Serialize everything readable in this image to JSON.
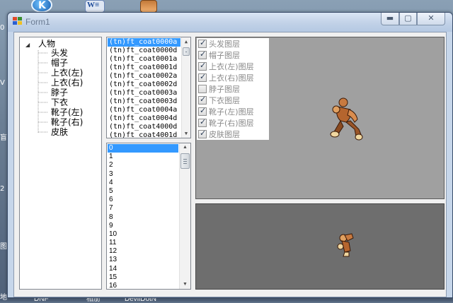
{
  "window": {
    "title": "Form1",
    "buttons": {
      "minimize": "▬",
      "maximize": "▢",
      "close": "✕"
    }
  },
  "desktop": {
    "icon_k_letter": "K",
    "icon_w_letter": "W≡",
    "left_chars": [
      "0",
      "Ⅴ",
      "盲",
      "2",
      "图",
      "地"
    ],
    "taskbar_labels": [
      "DNF",
      "相册",
      "DevilDotN"
    ]
  },
  "tree": {
    "root": "人物",
    "children": [
      "头发",
      "帽子",
      "上衣(左)",
      "上衣(右)",
      "脖子",
      "下衣",
      "靴子(左)",
      "靴子(右)",
      "皮肤"
    ]
  },
  "file_list": {
    "items": [
      "(tn)ft_coat0000a",
      "(tn)ft_coat0000d",
      "(tn)ft_coat0001a",
      "(tn)ft_coat0001d",
      "(tn)ft_coat0002a",
      "(tn)ft_coat0002d",
      "(tn)ft_coat0003a",
      "(tn)ft_coat0003d",
      "(tn)ft_coat0004a",
      "(tn)ft_coat0004d",
      "(tn)ft_coat4000d",
      "(tn)ft_coat4001d"
    ],
    "selected_index": 0
  },
  "frame_list": {
    "items": [
      "0",
      "1",
      "2",
      "3",
      "4",
      "5",
      "6",
      "7",
      "8",
      "9",
      "10",
      "11",
      "12",
      "13",
      "14",
      "15",
      "16"
    ],
    "selected_index": 0
  },
  "layers": [
    {
      "label": "头发图层",
      "checked": true
    },
    {
      "label": "帽子图层",
      "checked": true
    },
    {
      "label": "上衣(左)图层",
      "checked": true
    },
    {
      "label": "上衣(右)图层",
      "checked": true
    },
    {
      "label": "脖子图层",
      "checked": false
    },
    {
      "label": "下衣图层",
      "checked": true
    },
    {
      "label": "靴子(左)图层",
      "checked": true
    },
    {
      "label": "靴子(右)图层",
      "checked": true
    },
    {
      "label": "皮肤图层",
      "checked": true
    }
  ],
  "colors": {
    "selection": "#3399ff",
    "preview_top_bg": "#a0a0a0",
    "preview_bottom_bg": "#6e6e6e"
  }
}
